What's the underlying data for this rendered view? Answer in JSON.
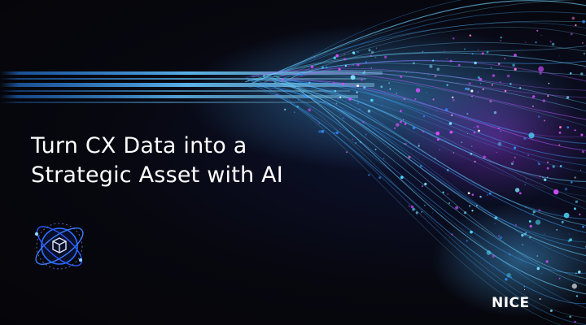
{
  "banner": {
    "headline_line1": "Turn CX Data into a",
    "headline_line2": "Strategic Asset with AI",
    "brand_logo_text": "NICE",
    "emblem_icon": "ai-cube-orbit-icon"
  },
  "colors": {
    "background": "#07070f",
    "headline_text": "#ffffff",
    "light_beam": "#3aa8ff",
    "particle_cyan": "#4fd8ff",
    "particle_magenta": "#d34cff",
    "emblem_ring": "#2a6cff"
  }
}
